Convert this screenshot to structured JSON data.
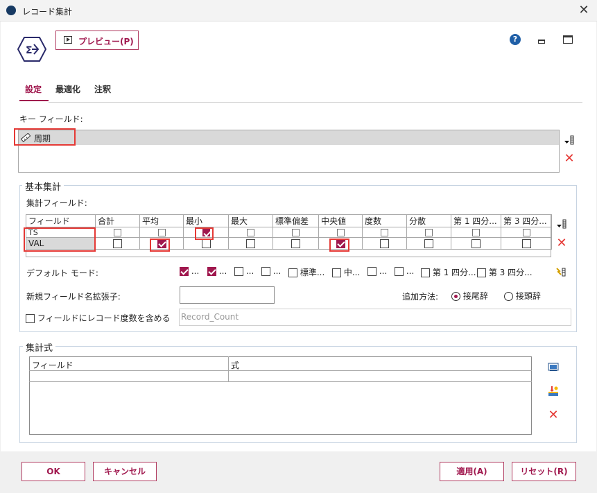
{
  "window": {
    "title": "レコード集計"
  },
  "toolbar": {
    "preview_label": "プレビュー(P)"
  },
  "tabs": [
    {
      "label": "設定",
      "active": true
    },
    {
      "label": "最適化",
      "active": false
    },
    {
      "label": "注釈",
      "active": false
    }
  ],
  "key_fields": {
    "label": "キー フィールド:",
    "items": [
      "周期"
    ]
  },
  "basic_aggregation": {
    "legend": "基本集計",
    "fields_label": "集計フィールド:",
    "columns": [
      "フィールド",
      "合計",
      "平均",
      "最小",
      "最大",
      "標準偏差",
      "中央値",
      "度数",
      "分散",
      "第 1 四分...",
      "第 3 四分..."
    ],
    "rows": [
      {
        "field": "TS",
        "checks": [
          false,
          false,
          true,
          false,
          false,
          false,
          false,
          false,
          false,
          false
        ]
      },
      {
        "field": "VAL",
        "checks": [
          false,
          true,
          false,
          false,
          false,
          true,
          false,
          false,
          false,
          false
        ]
      }
    ],
    "default_mode_label": "デフォルト モード:",
    "default_modes": [
      {
        "label": "...",
        "checked": true
      },
      {
        "label": "...",
        "checked": true
      },
      {
        "label": "...",
        "checked": false
      },
      {
        "label": "...",
        "checked": false
      },
      {
        "label": "標準...",
        "checked": false
      },
      {
        "label": "中...",
        "checked": false
      },
      {
        "label": "...",
        "checked": false
      },
      {
        "label": "...",
        "checked": false
      },
      {
        "label": "第 1 四分...",
        "checked": false
      },
      {
        "label": "第 3 四分...",
        "checked": false
      }
    ],
    "suffix_label": "新規フィールド名拡張子:",
    "suffix_value": "",
    "append_label": "追加方法:",
    "append_options": [
      {
        "label": "接尾辞",
        "selected": true
      },
      {
        "label": "接頭辞",
        "selected": false
      }
    ],
    "include_count_label": "フィールドにレコード度数を含める",
    "include_count_checked": false,
    "count_field_value": "Record_Count"
  },
  "expressions": {
    "legend": "集計式",
    "columns": [
      "フィールド",
      "式"
    ]
  },
  "footer": {
    "ok_label": "OK",
    "cancel_label": "キャンセル",
    "apply_label": "適用(A)",
    "reset_label": "リセット(R)"
  },
  "colors": {
    "accent": "#a0184e",
    "highlight": "#e53935",
    "link_blue": "#1f5fa7"
  }
}
